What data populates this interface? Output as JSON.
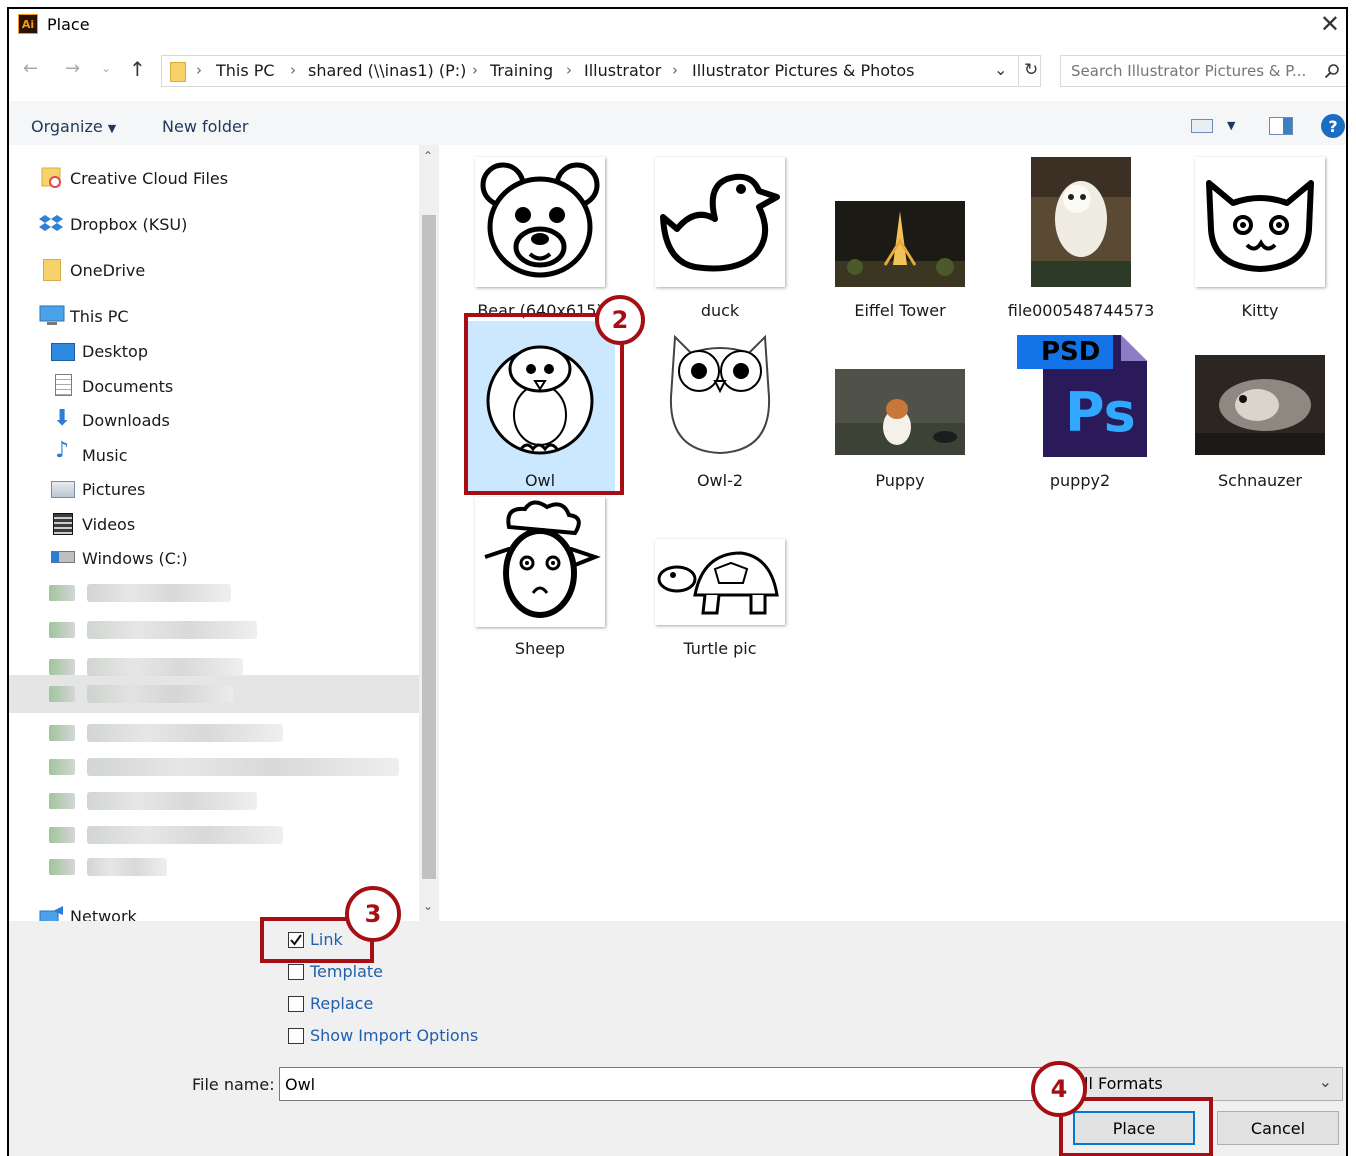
{
  "window": {
    "title": "Place",
    "close": "✕"
  },
  "breadcrumb": {
    "items": [
      "This PC",
      "shared (\\\\inas1) (P:)",
      "Training",
      "Illustrator",
      "Illustrator Pictures & Photos"
    ]
  },
  "search": {
    "placeholder": "Search Illustrator Pictures & P..."
  },
  "toolbar": {
    "organize": "Organize",
    "new_folder": "New folder"
  },
  "sidebar": {
    "items": [
      "Creative Cloud Files",
      "Dropbox (KSU)",
      "OneDrive",
      "This PC",
      "Desktop",
      "Documents",
      "Downloads",
      "Music",
      "Pictures",
      "Videos",
      "Windows (C:)",
      "Network"
    ]
  },
  "files": [
    "Bear (640x615)",
    "duck",
    "Eiffel Tower",
    "file000548744573",
    "Kitty",
    "Owl",
    "Owl-2",
    "Puppy",
    "puppy2",
    "Schnauzer",
    "Sheep",
    "Turtle pic"
  ],
  "psd_badge": {
    "label": "PSD",
    "ps": "Ps"
  },
  "options": {
    "link": "Link",
    "template": "Template",
    "replace": "Replace",
    "show_import": "Show Import Options"
  },
  "filename": {
    "label": "File name:",
    "value": "Owl"
  },
  "format": {
    "value": "ll Formats"
  },
  "buttons": {
    "place": "Place",
    "cancel": "Cancel"
  },
  "annotations": {
    "step2": "2",
    "step3": "3",
    "step4": "4"
  },
  "colors": {
    "callout": "#a50f14",
    "selection": "#cce8ff",
    "link_text": "#1f5fae",
    "primary_border": "#0078d7"
  }
}
